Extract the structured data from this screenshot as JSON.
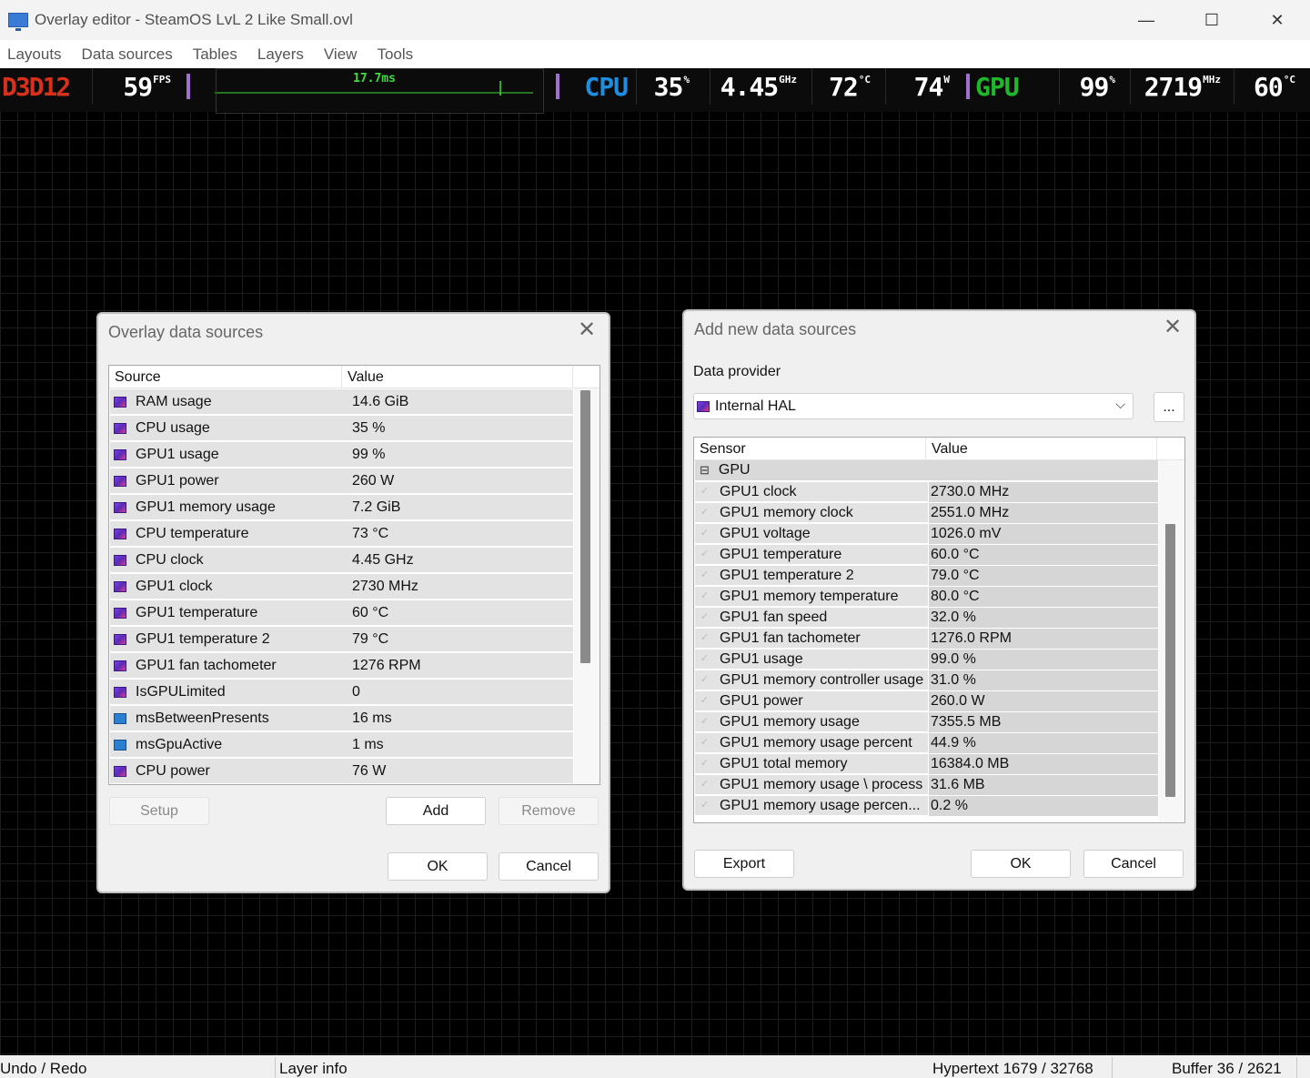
{
  "window": {
    "title": "Overlay editor - SteamOS LvL 2 Like Small.ovl",
    "controls": {
      "minimize": "—",
      "maximize": "☐",
      "close": "✕"
    }
  },
  "menu": [
    "Layouts",
    "Data sources",
    "Tables",
    "Layers",
    "View",
    "Tools"
  ],
  "osd": {
    "api": "D3D12",
    "fps": {
      "value": "59",
      "unit": "FPS"
    },
    "frametime": "17.7ms",
    "cpu_label": "CPU",
    "cpu_usage": {
      "value": "35",
      "unit": "%"
    },
    "cpu_clock": {
      "value": "4.45",
      "unit": "GHz"
    },
    "cpu_temp": {
      "value": "72",
      "unit": "°C"
    },
    "cpu_power": {
      "value": "74",
      "unit": "W"
    },
    "gpu_label": "GPU",
    "gpu_usage": {
      "value": "99",
      "unit": "%"
    },
    "gpu_clock": {
      "value": "2719",
      "unit": "MHz"
    },
    "gpu_temp": {
      "value": "60",
      "unit": "°C"
    },
    "colors": {
      "api": "#d9301c",
      "cpu": "#1e8fe0",
      "gpu": "#1fb82a",
      "separator": "#a070d0",
      "graph": "#3ddc3d"
    }
  },
  "overlay_dialog": {
    "title": "Overlay data sources",
    "columns": [
      "Source",
      "Value"
    ],
    "rows": [
      {
        "icon": "sensor-icon",
        "source": "RAM usage",
        "value": "14.6 GiB"
      },
      {
        "icon": "sensor-icon",
        "source": "CPU usage",
        "value": "35 %"
      },
      {
        "icon": "sensor-icon",
        "source": "GPU1 usage",
        "value": "99 %"
      },
      {
        "icon": "sensor-icon",
        "source": "GPU1 power",
        "value": "260 W"
      },
      {
        "icon": "sensor-icon",
        "source": "GPU1 memory usage",
        "value": "7.2 GiB"
      },
      {
        "icon": "sensor-icon",
        "source": "CPU temperature",
        "value": "73 °C"
      },
      {
        "icon": "sensor-icon",
        "source": "CPU clock",
        "value": "4.45 GHz"
      },
      {
        "icon": "sensor-icon",
        "source": "GPU1 clock",
        "value": "2730 MHz"
      },
      {
        "icon": "sensor-icon",
        "source": "GPU1 temperature",
        "value": "60 °C"
      },
      {
        "icon": "sensor-icon",
        "source": "GPU1 temperature 2",
        "value": "79 °C"
      },
      {
        "icon": "sensor-icon",
        "source": "GPU1 fan tachometer",
        "value": "1276 RPM"
      },
      {
        "icon": "sensor-icon",
        "source": "IsGPULimited",
        "value": "0"
      },
      {
        "icon": "chart-icon",
        "source": "msBetweenPresents",
        "value": "16 ms"
      },
      {
        "icon": "chart-icon",
        "source": "msGpuActive",
        "value": "1 ms"
      },
      {
        "icon": "sensor-icon",
        "source": "CPU power",
        "value": "76 W"
      }
    ],
    "buttons": {
      "setup": "Setup",
      "add": "Add",
      "remove": "Remove",
      "ok": "OK",
      "cancel": "Cancel"
    }
  },
  "add_dialog": {
    "title": "Add new data sources",
    "provider_label": "Data provider",
    "provider_value": "Internal HAL",
    "browse_label": "...",
    "columns": [
      "Sensor",
      "Value"
    ],
    "group": {
      "expander": "⊟",
      "name": "GPU"
    },
    "rows": [
      {
        "sensor": "GPU1 clock",
        "value": "2730.0 MHz"
      },
      {
        "sensor": "GPU1 memory clock",
        "value": "2551.0 MHz"
      },
      {
        "sensor": "GPU1 voltage",
        "value": "1026.0 mV"
      },
      {
        "sensor": "GPU1 temperature",
        "value": "60.0 °C"
      },
      {
        "sensor": "GPU1 temperature 2",
        "value": "79.0 °C"
      },
      {
        "sensor": "GPU1 memory temperature",
        "value": "80.0 °C"
      },
      {
        "sensor": "GPU1 fan speed",
        "value": "32.0 %"
      },
      {
        "sensor": "GPU1 fan tachometer",
        "value": "1276.0 RPM"
      },
      {
        "sensor": "GPU1 usage",
        "value": "99.0 %"
      },
      {
        "sensor": "GPU1 memory controller usage",
        "value": "31.0 %"
      },
      {
        "sensor": "GPU1 power",
        "value": "260.0 W"
      },
      {
        "sensor": "GPU1 memory usage",
        "value": "7355.5 MB"
      },
      {
        "sensor": "GPU1 memory usage percent",
        "value": "44.9 %"
      },
      {
        "sensor": "GPU1 total memory",
        "value": "16384.0 MB"
      },
      {
        "sensor": "GPU1 memory usage \\ process",
        "value": "31.6 MB"
      },
      {
        "sensor": "GPU1 memory usage percen...",
        "value": "0.2 %"
      }
    ],
    "buttons": {
      "export": "Export",
      "ok": "OK",
      "cancel": "Cancel"
    }
  },
  "status": {
    "undo": "Undo / Redo",
    "layer": "Layer info",
    "hypertext": "Hypertext 1679 / 32768",
    "buffer": "Buffer 36 / 2621"
  }
}
